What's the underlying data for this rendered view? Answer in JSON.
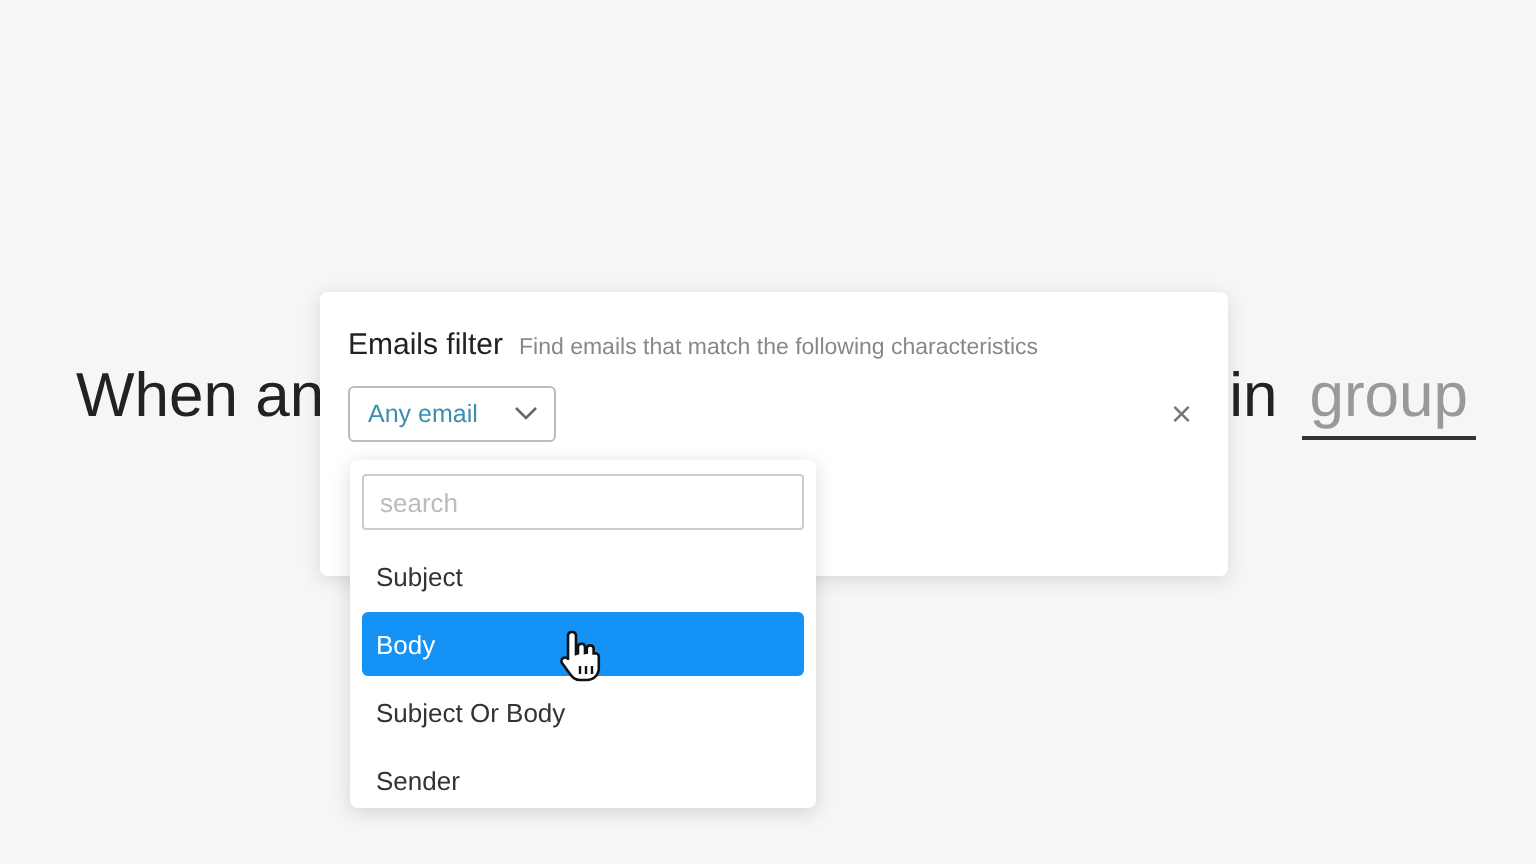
{
  "sentence": {
    "start": "When an",
    "end": "in",
    "link": "group"
  },
  "filter": {
    "title": "Emails filter",
    "subtitle": "Find emails that match the following characteristics",
    "select": "Any email",
    "close": "×"
  },
  "dropdown": {
    "search": {
      "placeholder": "search"
    },
    "options": [
      {
        "label": "Subject",
        "selected": false
      },
      {
        "label": "Body",
        "selected": true
      },
      {
        "label": "Subject Or Body",
        "selected": false
      },
      {
        "label": "Sender",
        "selected": false
      }
    ]
  }
}
